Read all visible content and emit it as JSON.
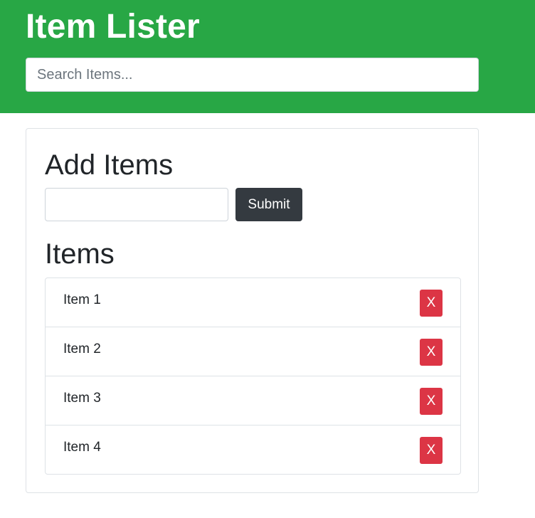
{
  "header": {
    "title": "Item Lister",
    "search_placeholder": "Search Items..."
  },
  "add_section": {
    "title": "Add Items",
    "input_value": "",
    "submit_label": "Submit"
  },
  "items_section": {
    "title": "Items",
    "items": [
      {
        "label": "Item 1",
        "delete_label": "X"
      },
      {
        "label": "Item 2",
        "delete_label": "X"
      },
      {
        "label": "Item 3",
        "delete_label": "X"
      },
      {
        "label": "Item 4",
        "delete_label": "X"
      }
    ]
  },
  "colors": {
    "header_bg": "#28a745",
    "submit_bg": "#343a40",
    "delete_bg": "#dc3545"
  }
}
